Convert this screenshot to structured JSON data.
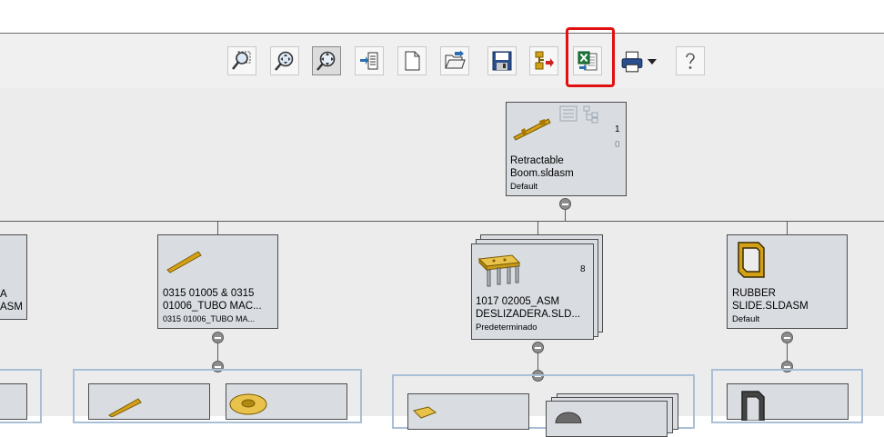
{
  "toolbar": {
    "buttons": [
      {
        "name": "zoom-to-area",
        "icon": "zoom-area-icon"
      },
      {
        "name": "zoom-to-fit",
        "icon": "zoom-fit-icon"
      },
      {
        "name": "zoom-pan",
        "icon": "zoom-pan-icon"
      },
      {
        "name": "show-bom",
        "icon": "list-arrow-icon"
      },
      {
        "name": "new-document",
        "icon": "page-icon"
      },
      {
        "name": "open",
        "icon": "folder-open-icon"
      },
      {
        "name": "save",
        "icon": "save-icon"
      },
      {
        "name": "replace",
        "icon": "swap-icon"
      },
      {
        "name": "export-excel",
        "icon": "excel-export-icon"
      },
      {
        "name": "print",
        "icon": "printer-icon"
      },
      {
        "name": "help",
        "icon": "help-icon"
      }
    ]
  },
  "tree": {
    "root": {
      "name_line1": "Retractable",
      "name_line2": "Boom.sldasm",
      "config": "Default",
      "count1": "1",
      "count2": "0"
    },
    "nodes": [
      {
        "name_line1": "A",
        "name_line2": "ASM",
        "config": ""
      },
      {
        "name_line1": "0315 01005 & 0315",
        "name_line2": "01006_TUBO MAC...",
        "config": "0315 01006_TUBO MA..."
      },
      {
        "name_line1": "1017 02005_ASM",
        "name_line2": "DESLIZADERA.SLD...",
        "config": "Predeterminado",
        "count": "8"
      },
      {
        "name_line1": "RUBBER",
        "name_line2": "SLIDE.SLDASM",
        "config": "Default"
      }
    ]
  },
  "colors": {
    "highlight": "#e01010",
    "part": "#d4a017",
    "card": "#d9dde2",
    "group_border": "#a8bfd6"
  }
}
